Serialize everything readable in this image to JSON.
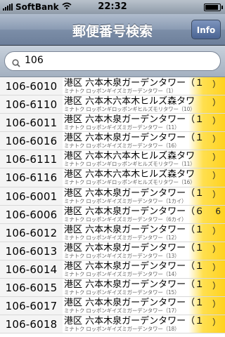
{
  "status_bar": {
    "carrier": "SoftBank",
    "time": "22:32",
    "wifi_icon": "wifi-icon",
    "battery_level": 0.9
  },
  "nav": {
    "title": "郵便番号検索",
    "info_label": "Info"
  },
  "search": {
    "value": "106",
    "icon": "search-icon"
  },
  "results": [
    {
      "code": "106-6010",
      "address": "港区 六本木泉ガーデンタワー（１",
      "kana": "ミナトク ロッポンギイズミガーデンタワー（1）",
      "floor": "）"
    },
    {
      "code": "106-6110",
      "address": "港区 六本木六本木ヒルズ森タワ",
      "kana": "ミナトク ロッポンギロッポンギヒルズモリタワー（10）",
      "floor": "）"
    },
    {
      "code": "106-6011",
      "address": "港区 六本木泉ガーデンタワー（１",
      "kana": "ミナトク ロッポンギイズミガーデンタワー（11）",
      "floor": "）"
    },
    {
      "code": "106-6016",
      "address": "港区 六本木泉ガーデンタワー（１",
      "kana": "ミナトク ロッポンギイズミガーデンタワー（16）",
      "floor": "）"
    },
    {
      "code": "106-6111",
      "address": "港区 六本木六本木ヒルズ森タワ",
      "kana": "ミナトク ロッポンギロッポンギヒルズモリタワー（11）",
      "floor": "）"
    },
    {
      "code": "106-6116",
      "address": "港区 六本木六本木ヒルズ森タワ",
      "kana": "ミナトク ロッポンギロッポンギヒルズモリタワー（16）",
      "floor": "）"
    },
    {
      "code": "106-6001",
      "address": "港区 六本木泉ガーデンタワー（１",
      "kana": "ミナトク ロッポンギイズミガーデンタワー（1カイ）",
      "floor": "）"
    },
    {
      "code": "106-6006",
      "address": "港区 六本木泉ガーデンタワー（６",
      "kana": "ミナトク ロッポンギイズミガーデンタワー（6カイ）",
      "floor": "6"
    },
    {
      "code": "106-6012",
      "address": "港区 六本木泉ガーデンタワー（１",
      "kana": "ミナトク ロッポンギイズミガーデンタワー（12）",
      "floor": "）"
    },
    {
      "code": "106-6013",
      "address": "港区 六本木泉ガーデンタワー（１",
      "kana": "ミナトク ロッポンギイズミガーデンタワー（13）",
      "floor": "）"
    },
    {
      "code": "106-6014",
      "address": "港区 六本木泉ガーデンタワー（１",
      "kana": "ミナトク ロッポンギイズミガーデンタワー（14）",
      "floor": "）"
    },
    {
      "code": "106-6015",
      "address": "港区 六本木泉ガーデンタワー（１",
      "kana": "ミナトク ロッポンギイズミガーデンタワー（15）",
      "floor": "）"
    },
    {
      "code": "106-6017",
      "address": "港区 六本木泉ガーデンタワー（１",
      "kana": "ミナトク ロッポンギイズミガーデンタワー（17）",
      "floor": "）"
    },
    {
      "code": "106-6018",
      "address": "港区 六本木泉ガーデンタワー（１",
      "kana": "ミナトク ロッポンギイズミガーデンタワー（18）",
      "floor": "）"
    }
  ]
}
